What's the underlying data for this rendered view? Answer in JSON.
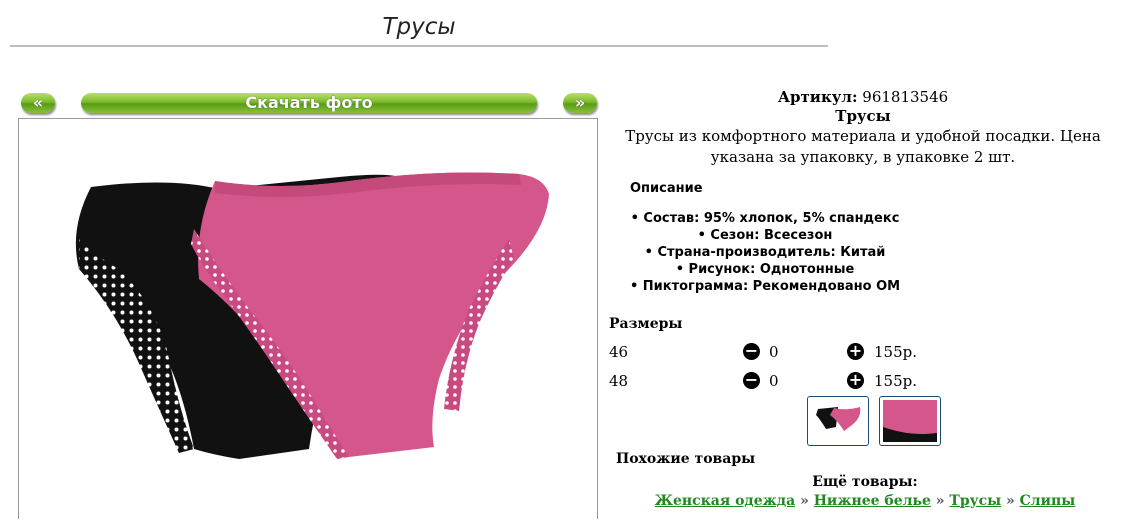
{
  "header": {
    "title": "Трусы"
  },
  "gallery": {
    "prev_label": "«",
    "download_label": "Скачать фото",
    "next_label": "»"
  },
  "product": {
    "article_label": "Артикул:",
    "article_value": "961813546",
    "name": "Трусы",
    "description": "Трусы из комфортного материала и удобной посадки. Цена указана за упаковку, в упаковке 2 шт."
  },
  "description_section": {
    "heading": "Описание",
    "properties": [
      "Состав: 95% хлопок, 5% спандекс",
      "Сезон: Всесезон",
      "Страна-производитель: Китай",
      "Рисунок: Однотонные",
      "Пиктограмма: Рекомендовано ОМ"
    ]
  },
  "sizes": {
    "heading": "Размеры",
    "rows": [
      {
        "size": "46",
        "qty": "0",
        "price": "155р."
      },
      {
        "size": "48",
        "qty": "0",
        "price": "155р."
      }
    ]
  },
  "similar": {
    "heading": "Похожие товары"
  },
  "more": {
    "heading": "Ещё товары:",
    "breadcrumbs": [
      "Женская одежда",
      "Нижнее белье",
      "Трусы",
      "Слипы"
    ],
    "separator": "»"
  },
  "colors": {
    "button_green": "#7cbb2a",
    "link_green": "#1e8a1e",
    "pink": "#d4568a"
  }
}
